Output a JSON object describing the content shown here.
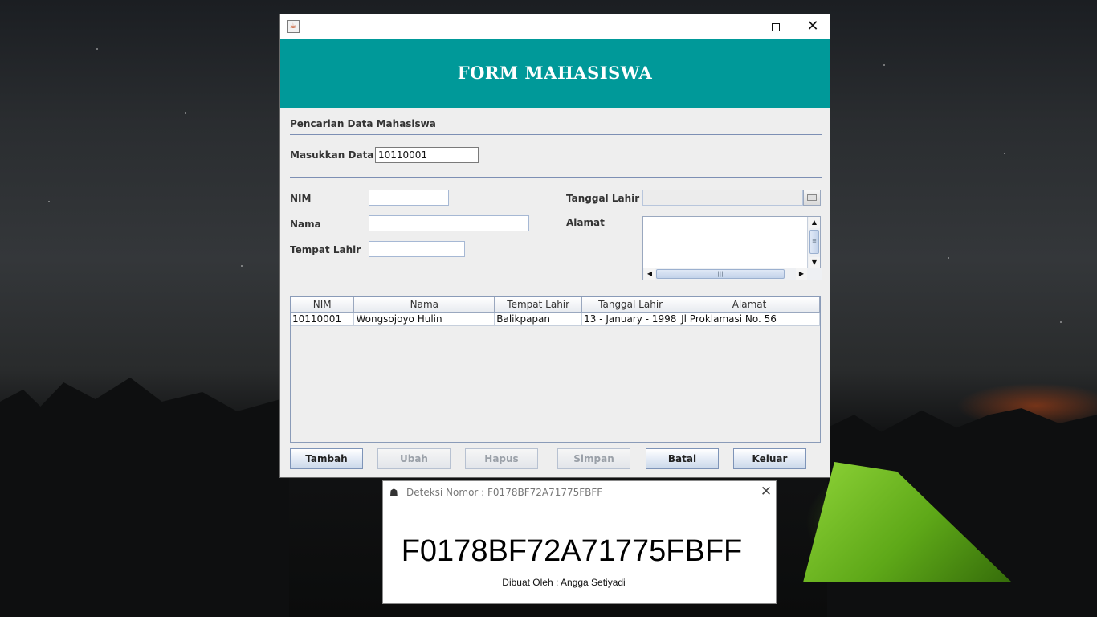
{
  "window": {
    "app_icon": "java-cup-icon",
    "header_title": "FORM MAHASISWA"
  },
  "search": {
    "section_title": "Pencarian Data Mahasiswa",
    "label": "Masukkan Data",
    "value": "10110001"
  },
  "form": {
    "nim_label": "NIM",
    "nim_value": "",
    "nama_label": "Nama",
    "nama_value": "",
    "tempat_label": "Tempat Lahir",
    "tempat_value": "",
    "tanggal_label": "Tanggal Lahir",
    "tanggal_value": "",
    "alamat_label": "Alamat",
    "alamat_value": ""
  },
  "table": {
    "columns": [
      "NIM",
      "Nama",
      "Tempat Lahir",
      "Tanggal Lahir",
      "Alamat"
    ],
    "rows": [
      [
        "10110001",
        "Wongsojoyo Hulin",
        "Balikpapan",
        "13 - January - 1998",
        "Jl Proklamasi No. 56"
      ]
    ]
  },
  "buttons": {
    "tambah": "Tambah",
    "ubah": "Ubah",
    "hapus": "Hapus",
    "simpan": "Simpan",
    "batal": "Batal",
    "keluar": "Keluar"
  },
  "dialog": {
    "icon": "java-duke-icon",
    "title": "Deteksi Nomor : F0178BF72A71775FBFF",
    "number": "F0178BF72A71775FBFF",
    "credit": "Dibuat Oleh : Angga Setiyadi"
  },
  "colors": {
    "header_bg": "#009999",
    "window_bg": "#eeeeee"
  }
}
